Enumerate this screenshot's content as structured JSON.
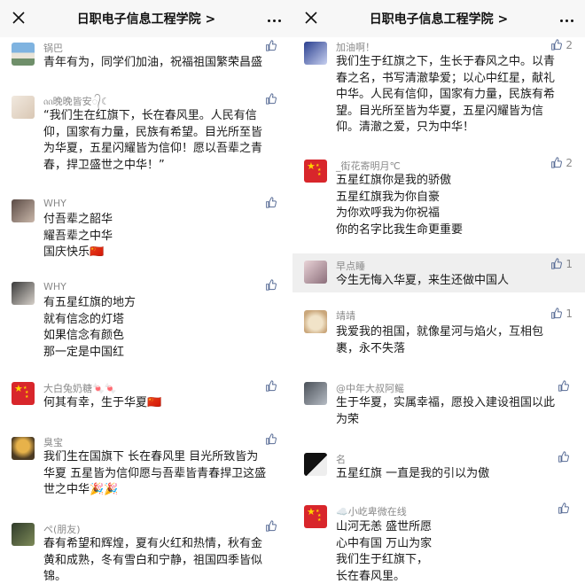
{
  "header": {
    "title": "日职电子信息工程学院 >"
  },
  "left_comments": [
    {
      "name": "锅巴",
      "likes": "",
      "lines": [
        "青年有为，同学们加油，祝福祖国繁荣昌盛"
      ]
    },
    {
      "name": "ᦶ晚晚皆安᭄☾",
      "likes": "",
      "lines": [
        "“我们生在红旗下，长在春风里。人民有信",
        "仰，国家有力量，民族有希望。目光所至皆",
        "为华夏，五星闪耀皆为信仰！愿以吾辈之青",
        "春，捍卫盛世之中华！”"
      ]
    },
    {
      "name": "WHY",
      "likes": "",
      "lines": [
        "付吾辈之韶华",
        "耀吾辈之中华",
        "国庆快乐🇨🇳"
      ]
    },
    {
      "name": "WHY",
      "likes": "",
      "lines": [
        "有五星红旗的地方",
        "就有信念的灯塔",
        "如果信念有颜色",
        "那一定是中国红"
      ]
    },
    {
      "name": "大白兔奶糖🍬🍬",
      "likes": "",
      "lines": [
        "何其有幸，生于华夏🇨🇳"
      ]
    },
    {
      "name": "臭宝",
      "likes": "",
      "lines": [
        "我们生在国旗下  长在春风里  目光所致皆为",
        "华夏  五星皆为信仰愿与吾辈皆青春捍卫这盛",
        "世之中华🎉🎉"
      ]
    },
    {
      "name": "ペ(朋友)",
      "likes": "",
      "lines": [
        "春有希望和辉煌，夏有火红和热情，秋有金",
        "黄和成熟，冬有雪白和宁静，祖国四季皆似",
        "锦。"
      ]
    }
  ],
  "right_comments": [
    {
      "name": "加油啊！",
      "likes": "2",
      "lines": [
        "我们生于红旗之下，生长于春风之中。以青",
        "春之名，书写清澈挚爱；以心中红星，献礼",
        "中华。人民有信仰，国家有力量，民族有希",
        "望。目光所至皆为华夏，五星闪耀皆为信",
        "仰。清澈之爱，只为中华！"
      ]
    },
    {
      "name": "_街花寄明月℃",
      "likes": "2",
      "lines": [
        "五星红旗你是我的骄傲",
        "五星红旗我为你自豪",
        "为你欢呼我为你祝福",
        "你的名字比我生命更重要"
      ]
    },
    {
      "name": "早点睡",
      "likes": "1",
      "lines": [
        "今生无悔入华夏，来生还做中国人"
      ]
    },
    {
      "name": "靖靖",
      "likes": "1",
      "lines": [
        "我爱我的祖国，就像星河与焰火，互相包",
        "裹，永不失落"
      ]
    },
    {
      "name": "@中年大叔阿鳐",
      "likes": "",
      "lines": [
        "生于华夏，实属幸福，愿投入建设祖国以此",
        "为荣"
      ]
    },
    {
      "name": "名",
      "likes": "",
      "lines": [
        "五星红旗 一直是我的引以为傲"
      ]
    },
    {
      "name": "☁️小屹卑微在线",
      "likes": "",
      "lines": [
        "山河无恙 盛世所愿",
        "心中有国 万山为家",
        "我们生于红旗下，",
        "长在春风里。"
      ]
    }
  ],
  "colors": {
    "topbar_bg": "#f7f7f7",
    "name_gray": "#8a8a8a",
    "like_blue": "#576b95",
    "highlight_bg": "#efefef",
    "flag_red": "#d8262b",
    "flag_star": "#ffd200"
  },
  "icons": [
    "close-icon",
    "more-icon",
    "thumbs-up-icon"
  ]
}
